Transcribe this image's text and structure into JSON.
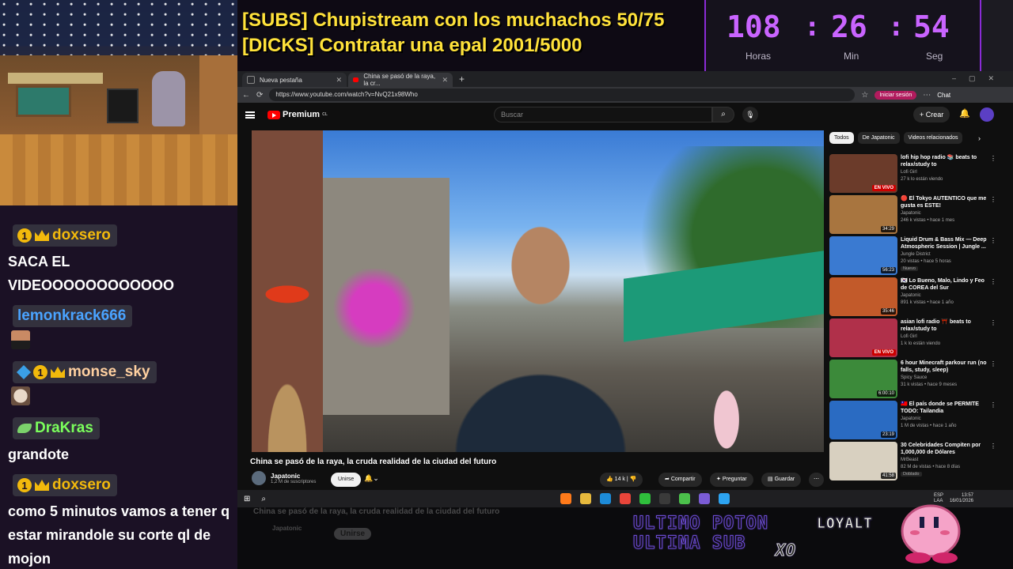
{
  "overlay": {
    "goal1": "[SUBS] Chupistream con los muchachos 50/75",
    "goal2": "[DICKS] Contratar una epal 2001/5000",
    "timer": {
      "hours": "108",
      "minutes": "26",
      "seconds": "54",
      "sep": ":",
      "hours_label": "Horas",
      "minutes_label": "Min",
      "seconds_label": "Seg"
    },
    "alert_line1": "ULTIMO POTON",
    "alert_line2": "ULTIMA SUB",
    "loyalty": "LOYALT",
    "xo": "XO"
  },
  "chat": [
    {
      "user": "doxsero",
      "color": "#f2b90c",
      "badges": [
        "1",
        "crown"
      ],
      "text": "SACA EL VIDEOOOOOOOOOOOO"
    },
    {
      "user": "lemonkrack666",
      "color": "#4aa3ff",
      "badges": [],
      "text": "",
      "emote": "face"
    },
    {
      "user": "monse_sky",
      "color": "#ffd0a0",
      "badges": [
        "cube",
        "1",
        "crown"
      ],
      "text": "",
      "emote": "cat"
    },
    {
      "user": "DraKras",
      "color": "#7bff5c",
      "badges": [
        "leaf"
      ],
      "text": "grandote"
    },
    {
      "user": "doxsero",
      "color": "#f2b90c",
      "badges": [
        "1",
        "crown"
      ],
      "text": "como 5 minutos vamos a tener q estar mirandole su corte ql de mojon"
    }
  ],
  "browser": {
    "tabs": [
      {
        "label": "Nueva pestaña"
      },
      {
        "label": "China se pasó de la raya, la cr..."
      }
    ],
    "url": "https://www.youtube.com/watch?v=NvQ21x98Who",
    "signin": "Iniciar sesión",
    "chat": "Chat"
  },
  "youtube": {
    "logo": "Premium",
    "logo_sup": "CL",
    "search_placeholder": "Buscar",
    "create": "Crear",
    "video": {
      "title": "China se pasó de la raya, la cruda realidad de la ciudad del futuro",
      "channel": "Japatonic",
      "subs": "1,2 M de suscriptores",
      "join": "Unirse",
      "likes": "14 k",
      "share": "Compartir",
      "ask": "Preguntar",
      "save": "Guardar"
    },
    "chips": [
      "Todos",
      "De Japatonic",
      "Videos relacionados"
    ],
    "related": [
      {
        "title": "lofi hip hop radio 📚 beats to relax/study to",
        "channel": "Lofi Girl",
        "meta": "27 k lo están viendo",
        "badge": "EN VIVO",
        "thumb": "#6b3b2a"
      },
      {
        "title": "🔴 El Tokyo AUTENTICO que me gusta es ESTE!",
        "channel": "Japatonic",
        "meta": "246 k vistas • hace 1 mes",
        "badge": "34:29",
        "thumb": "#a8753f"
      },
      {
        "title": "Liquid Drum & Bass Mix — Deep Atmospheric Session | Jungle ...",
        "channel": "Jungle District",
        "meta": "20 vistas • hace 5 horas",
        "badge": "56:23",
        "thumb": "#3a7ad1",
        "extra": "Nuevo"
      },
      {
        "title": "🇰🇷 Lo Bueno, Malo, Lindo y Feo de COREA del Sur",
        "channel": "Japatonic",
        "meta": "891 k vistas • hace 1 año",
        "badge": "35:46",
        "thumb": "#c25a2a"
      },
      {
        "title": "asian lofi radio ⛩️ beats to relax/study to",
        "channel": "Lofi Girl",
        "meta": "1 k lo están viendo",
        "badge": "EN VIVO",
        "thumb": "#b0304a"
      },
      {
        "title": "6 hour Minecraft parkour run (no falls, study, sleep)",
        "channel": "Spicy Sauce",
        "meta": "31 k vistas • hace 9 meses",
        "badge": "6:00:10",
        "thumb": "#3c8a3a"
      },
      {
        "title": "🇹🇼 El país donde se PERMITE TODO: Tailandia",
        "channel": "Japatonic",
        "meta": "1 M de vistas • hace 1 año",
        "badge": "23:19",
        "thumb": "#2a6bc2"
      },
      {
        "title": "30 Celebridades Compiten por 1,000,000 de Dólares",
        "channel": "MrBeast",
        "meta": "82 M de vistas • hace 8 días",
        "badge": "41:58",
        "thumb": "#d8d0c0",
        "extra": "Doblado"
      }
    ]
  },
  "taskbar": {
    "lang1": "ESP",
    "lang2": "LAA",
    "time": "13:57",
    "date": "16/01/2026"
  },
  "ghost": {
    "title": "China se pasó de la raya, la cruda realidad de la ciudad del futuro",
    "channel": "Japatonic",
    "join": "Unirse"
  },
  "colors": {
    "accent": "#c964ff",
    "goal": "#ffe23a",
    "chat_bg": "#1b1125",
    "yt_bg": "#0f0f0f"
  }
}
